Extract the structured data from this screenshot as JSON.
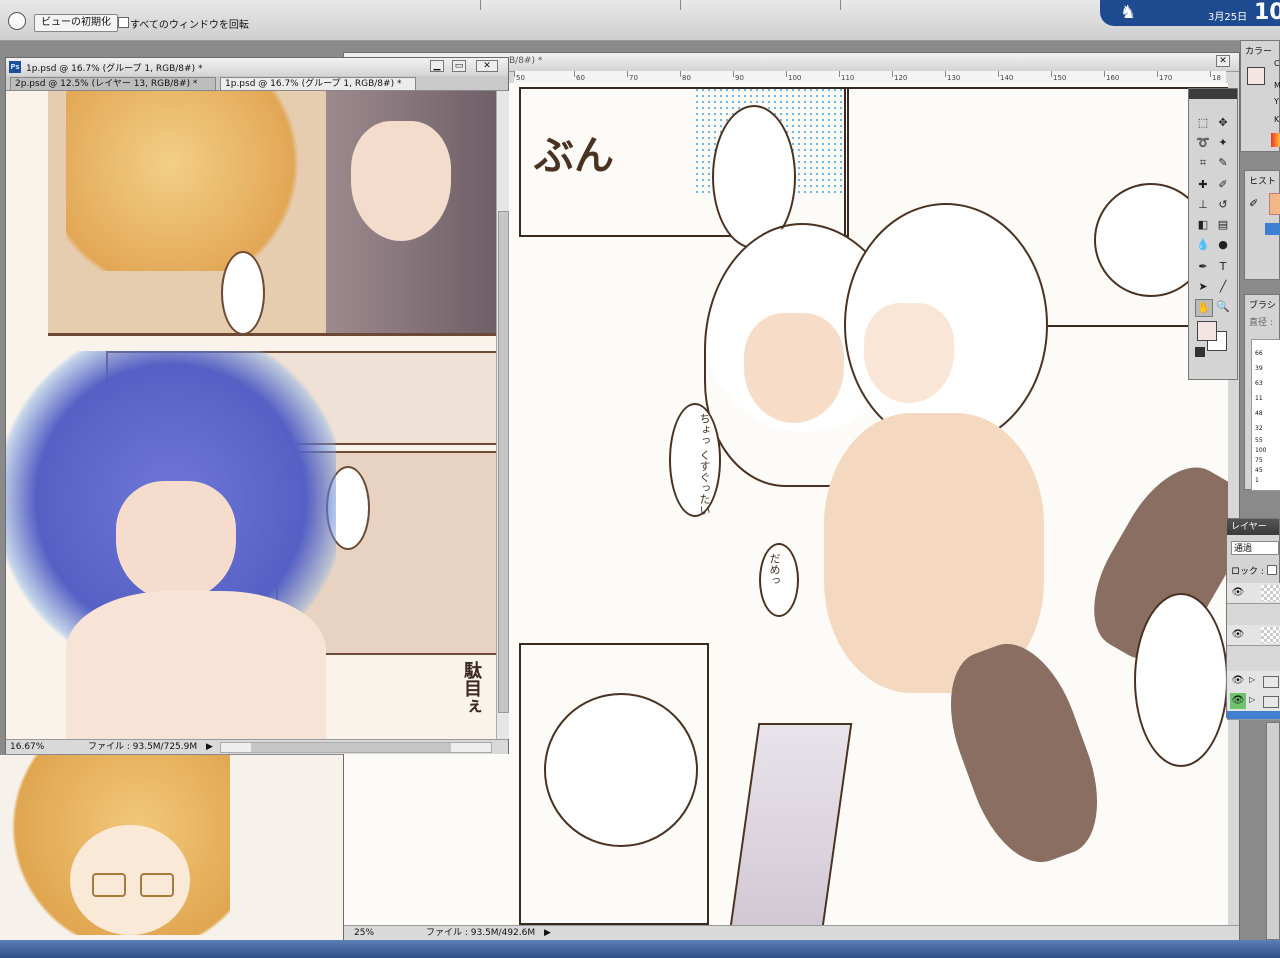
{
  "options_bar": {
    "reset_view_label": "ビューの初期化",
    "rotate_all_label": "すべてのウィンドウを回転"
  },
  "taskbar_clock": {
    "date": "3月25日",
    "time_partial": "10"
  },
  "window_front": {
    "title": "1p.psd @ 16.7% (グループ 1, RGB/8#) *",
    "tabs": [
      {
        "label": "2p.psd @ 12.5% (レイヤー 13, RGB/8#) *"
      },
      {
        "label": "1p.psd @ 16.7% (グループ 1, RGB/8#) *"
      }
    ],
    "zoom": "16.67%",
    "file_info": "ファイル : 93.5M/725.9M",
    "app_icon": "Ps"
  },
  "window_back": {
    "title_partial": "B/8#) *",
    "zoom": "25%",
    "file_info": "ファイル : 93.5M/492.6M",
    "ruler_numbers": [
      "50",
      "60",
      "70",
      "80",
      "90",
      "100",
      "110",
      "120",
      "130",
      "140",
      "150",
      "160",
      "170",
      "18"
    ]
  },
  "manga_text": {
    "sfx_top": "ぶん",
    "bubble_1": "ちょっ くすぐったい",
    "bubble_2": "だめっ",
    "left_text": "駄目ぇ"
  },
  "color_panel": {
    "title": "カラー",
    "channels": [
      "C",
      "M",
      "Y",
      "K"
    ]
  },
  "history_panel": {
    "title": "ヒスト"
  },
  "brush_panel": {
    "title": "ブラシ",
    "diameter_label": "直径 :",
    "sizes": [
      "66",
      "39",
      "63",
      "11",
      "48",
      "32",
      "55",
      "100",
      "75",
      "45",
      "1"
    ]
  },
  "layers_panel": {
    "title": "レイヤー",
    "blend_mode": "通過",
    "lock_label": "ロック :"
  },
  "colors": {
    "accent_cyan": "#00b4d8",
    "ps_blue": "#1f4f9a",
    "layer_selected": "#3f7fd1",
    "ink": "#4a3222"
  }
}
